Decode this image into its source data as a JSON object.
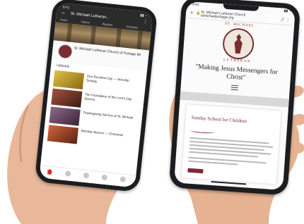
{
  "left_phone": {
    "app": "YouTube",
    "status_time": "9:41",
    "status_icons": "▮▮ ◔",
    "header_title": "St. Michael Lutheran...",
    "tabs": [
      "Home",
      "Videos",
      "Playlists",
      "Channels"
    ],
    "channel_name": "St. Michael Lutheran Church of Portage MI",
    "channel_subs": "",
    "section_label": "Uploads",
    "videos": [
      {
        "title": "Zion Rockfest Day — Worship Sunday",
        "meta": "",
        "thumb_color": "#c9a227"
      },
      {
        "title": "The Foundation of the Lord's Day Service",
        "meta": "",
        "thumb_color": "#8a3a2e"
      },
      {
        "title": "Thanksgiving Service at St. Michael",
        "meta": "",
        "thumb_color": "#6d4a6b"
      },
      {
        "title": "Worship Service — Christmas",
        "meta": "",
        "thumb_color": "#b84b2c"
      }
    ],
    "bottom_nav": [
      "home",
      "explore",
      "add",
      "subscriptions",
      "library"
    ]
  },
  "right_phone": {
    "status_time": "9:41",
    "status_icons": "▮▮ ◔",
    "url": "St. Michael Lutheran Church stmichaelportage.org",
    "url_actions": "⤴ ⋮",
    "church_name_top": "ST. MICHAEL",
    "church_name_bottom": "LUTHERAN",
    "tagline": "\"Making Jesus Messengers for Christ\"",
    "card_title": "Sunday School for Children",
    "accent_color": "#7b2b34"
  }
}
